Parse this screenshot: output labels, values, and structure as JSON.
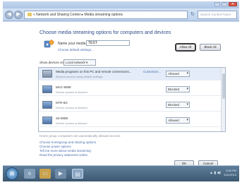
{
  "window": {
    "controls": [
      "—",
      "□",
      "✕"
    ]
  },
  "nav": {
    "back_glyph": "◀",
    "forward_glyph": "▶",
    "breadcrumb": "« Network and Sharing Center ▸ Media streaming options",
    "refresh_glyph": "↻",
    "search_placeholder": "Search Control Panel"
  },
  "main": {
    "heading": "Choose media streaming options for computers and devices",
    "library_label": "Name your media library:",
    "library_value": "TEST",
    "choose_default_link": "Choose default settings...",
    "show_devices_label": "Show devices on:",
    "show_devices_value": "Local network ▾",
    "allow_all_label": "Allow All",
    "block_all_label": "Block All",
    "devices": [
      {
        "name": "Media programs on this PC and remote connections...",
        "status": "Allowed access using default settings.",
        "link": "Customize...",
        "access": "Allowed",
        "icon": "media-library-icon"
      },
      {
        "name": "MAC-9089",
        "status": "Device access is blocked",
        "link": "",
        "access": "Blocked",
        "icon": "computer-icon"
      },
      {
        "name": "NTR-5G",
        "status": "Device access is blocked",
        "link": "",
        "access": "Blocked",
        "icon": "computer-icon"
      },
      {
        "name": "S4-9089",
        "status": "Device access is allowed",
        "link": "",
        "access": "Allowed",
        "icon": "computer-icon"
      }
    ],
    "footnote": "Home group computers are automatically allowed access.",
    "links": [
      "Choose homegroup and sharing options",
      "Choose power options",
      "Tell me more about media streaming",
      "Read the privacy statement online"
    ],
    "ok_label": "OK",
    "cancel_label": "Cancel"
  },
  "taskbar": {
    "start_glyph": "⊞",
    "tray": "▲ ▮ ◀)",
    "time": "3:45 PM",
    "date": "6/11/2013"
  },
  "colors": {
    "heading": "#2c4d8a",
    "link": "#4a6db0",
    "taskbar": "#3c5770"
  }
}
